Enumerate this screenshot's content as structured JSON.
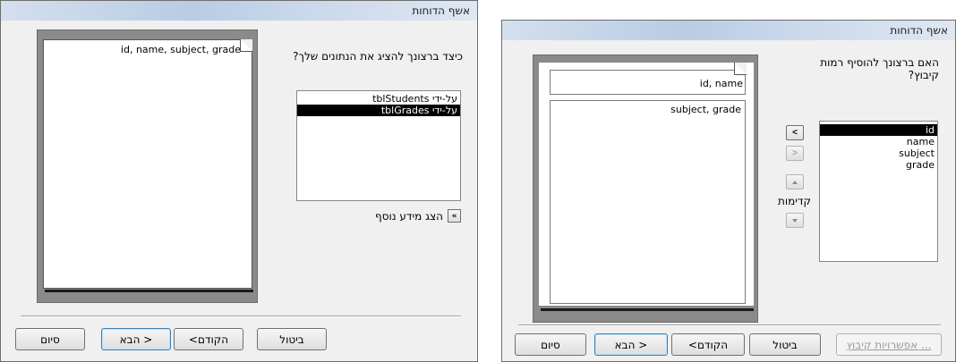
{
  "left_window": {
    "title": "אשף הדוחות",
    "question": "כיצד ברצונך להציג את הנתונים שלך?",
    "preview_fields": "id, name, subject, grade",
    "list_items": [
      {
        "label": "על-ידי tblStudents",
        "selected": false
      },
      {
        "label": "על-ידי tblGrades",
        "selected": true
      }
    ],
    "more_info_label": "הצג מידע נוסף",
    "more_info_icon": "double-chevron-icon",
    "buttons": {
      "cancel": "ביטול",
      "back": "<הקודם",
      "next": "הבא >",
      "finish": "סיום"
    }
  },
  "right_window": {
    "title": "אשף הדוחות",
    "question": "האם ברצונך להוסיף רמות קיבוץ?",
    "preview_group_field": "id, name",
    "preview_detail_fields": "subject, grade",
    "list_items": [
      {
        "label": "id",
        "selected": true
      },
      {
        "label": "name",
        "selected": false
      },
      {
        "label": "subject",
        "selected": false
      },
      {
        "label": "grade",
        "selected": false
      }
    ],
    "add_level": "<",
    "remove_level": ">",
    "priority_label": "קדימות",
    "buttons": {
      "grouping_options": "אפשרויות קיבוץ ...",
      "cancel": "ביטול",
      "back": "<הקודם",
      "next": "הבא >",
      "finish": "סיום"
    }
  }
}
